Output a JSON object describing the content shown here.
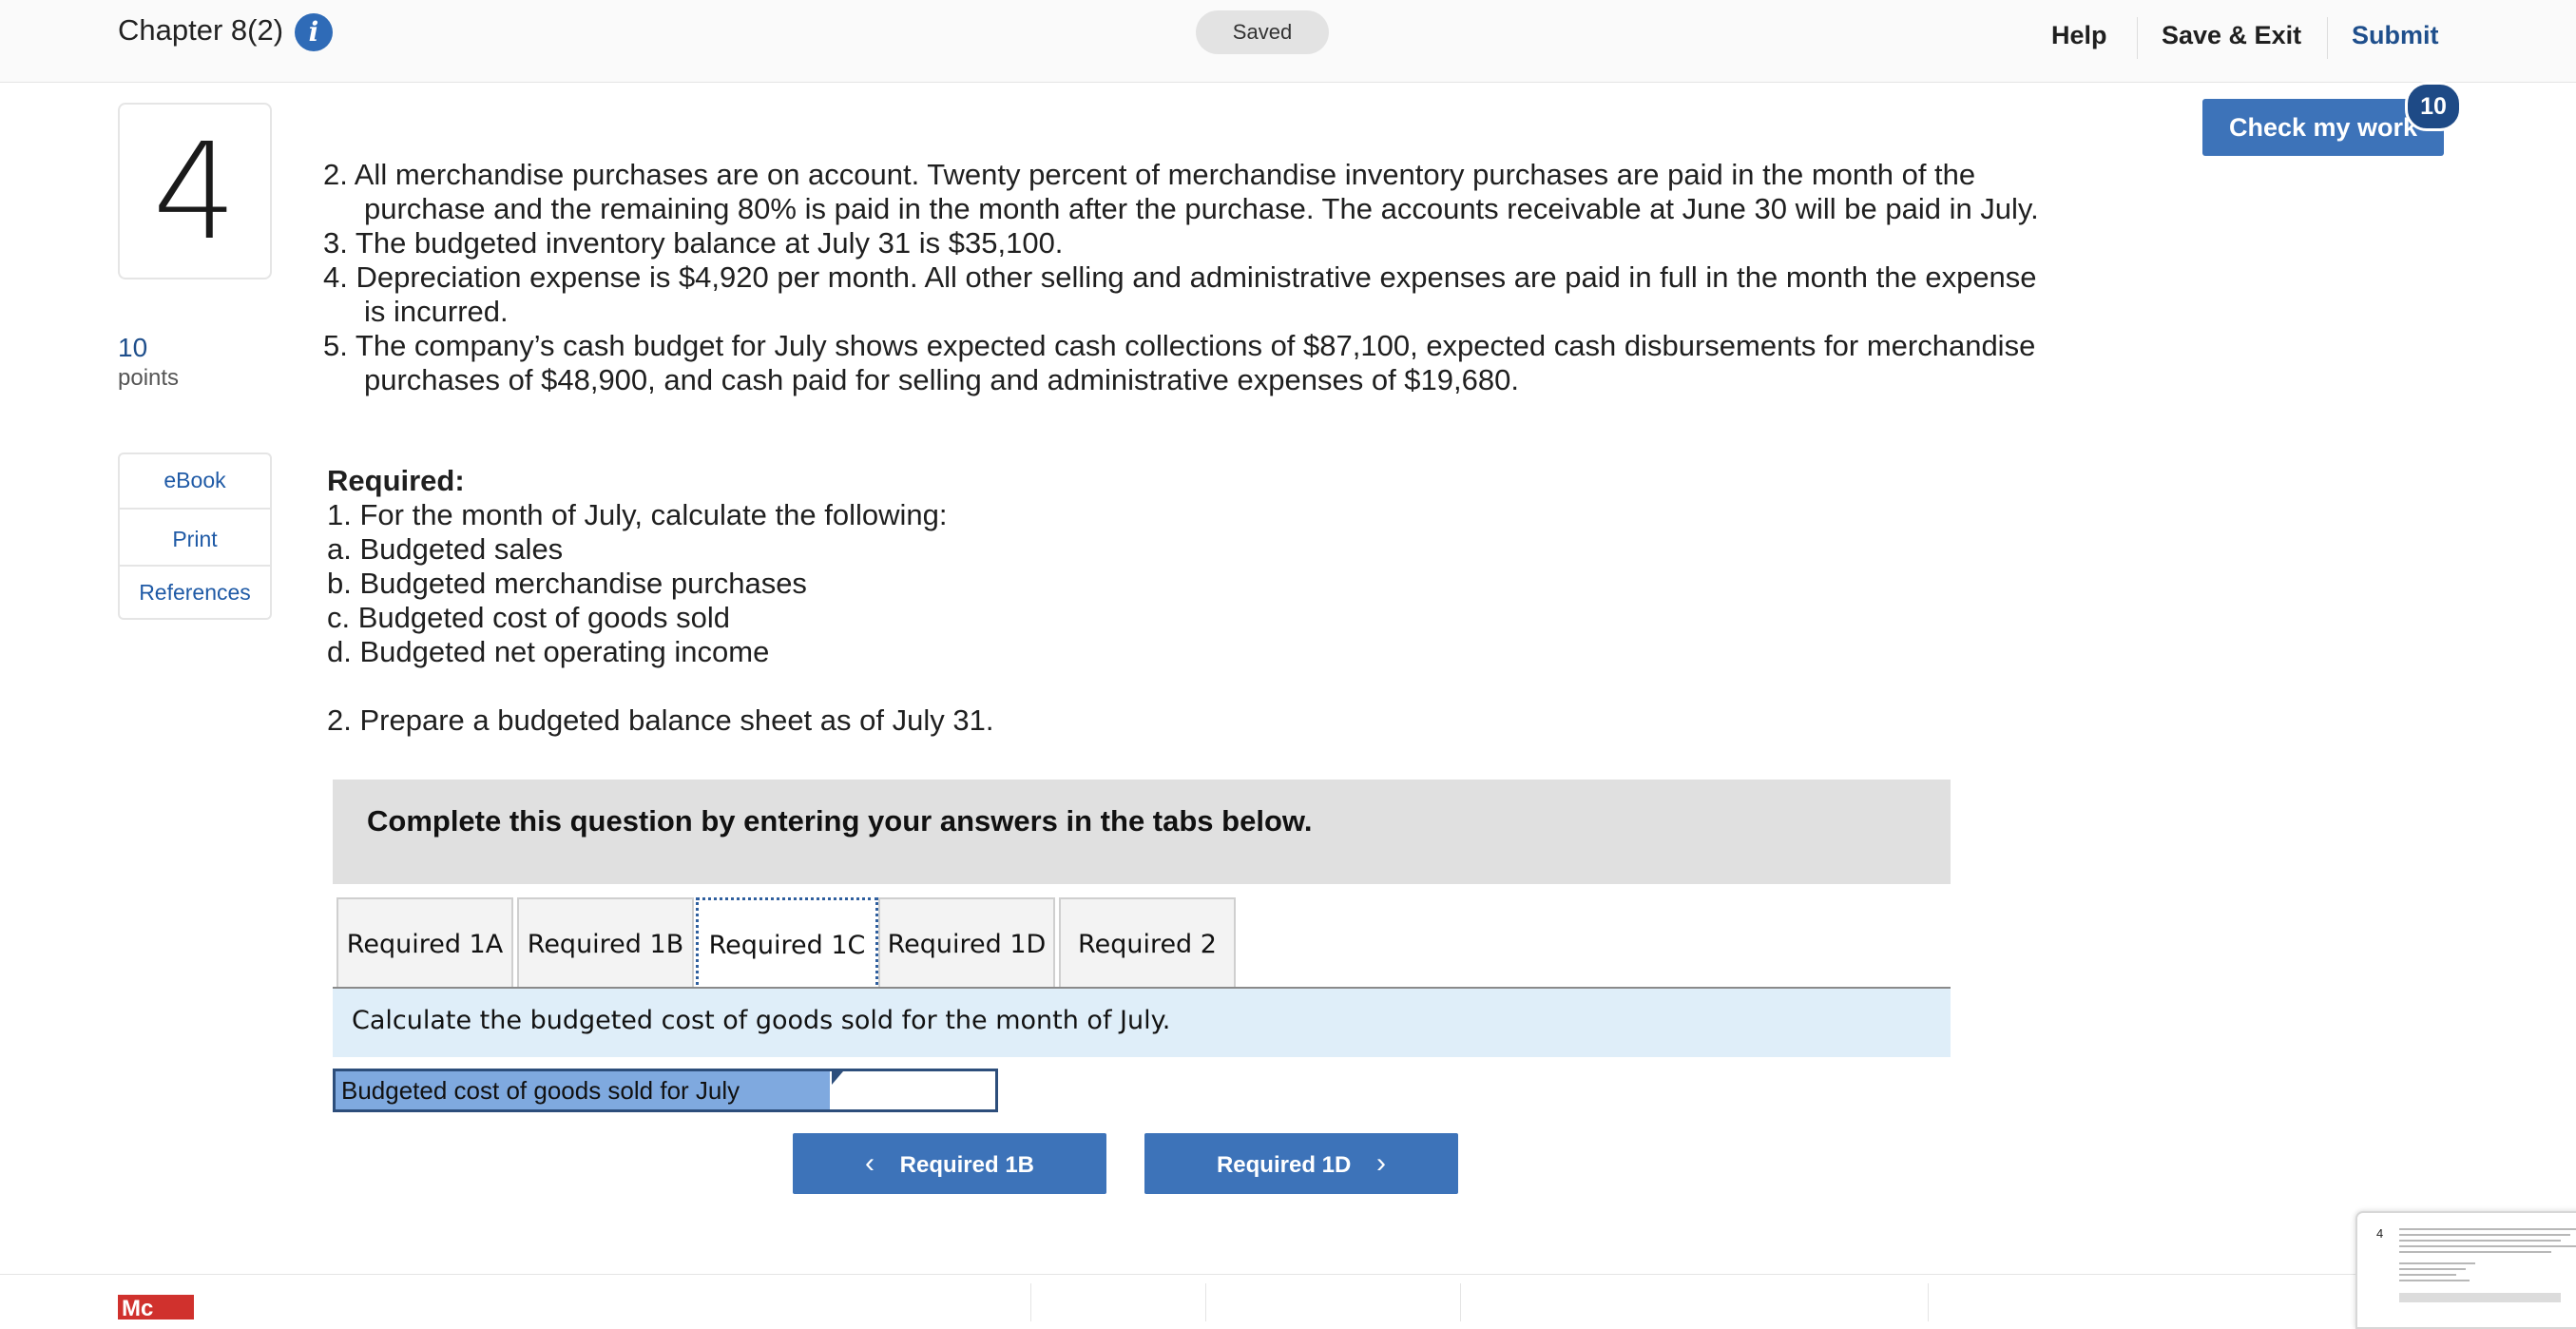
{
  "header": {
    "chapter_title": "Chapter 8(2)",
    "info_icon": "info-icon",
    "status": "Saved",
    "help": "Help",
    "save_exit": "Save & Exit",
    "submit": "Submit"
  },
  "question": {
    "number": "4",
    "points_value": "10",
    "points_label": "points"
  },
  "side_links": [
    "eBook",
    "Print",
    "References"
  ],
  "check_my_work": {
    "label": "Check my work",
    "badge": "10"
  },
  "body_lines": [
    "2.  All merchandise purchases are on account. Twenty percent of merchandise inventory purchases are paid in the month of the",
    "purchase and the remaining 80% is paid in the month after the purchase. The accounts receivable at June 30 will be paid in July.",
    "3.  The budgeted inventory balance at July 31 is $35,100.",
    "4.  Depreciation expense is $4,920 per month. All other selling and administrative expenses are paid in full in the month the expense",
    "is incurred.",
    "5.  The company’s cash budget for July shows expected cash collections of $87,100, expected cash disbursements for merchandise",
    "purchases of $48,900, and cash paid for selling and administrative expenses of $19,680."
  ],
  "required": {
    "title": "Required:",
    "intro": "1. For the month of July, calculate the following:",
    "items": [
      "a. Budgeted sales",
      "b. Budgeted merchandise purchases",
      "c. Budgeted cost of goods sold",
      "d. Budgeted net operating income"
    ],
    "part2": "2. Prepare a budgeted balance sheet as of July 31."
  },
  "instructions": "Complete this question by entering your answers in the tabs below.",
  "tabs": [
    "Required 1A",
    "Required 1B",
    "Required 1C",
    "Required 1D",
    "Required 2"
  ],
  "active_tab": "Required 1C",
  "prompt": "Calculate the budgeted cost of goods sold for the month of July.",
  "answer": {
    "label": "Budgeted cost of goods sold for July",
    "value": ""
  },
  "nav": {
    "prev": "Required 1B",
    "next": "Required 1D"
  },
  "footer": {
    "logo_text": "Mc"
  },
  "thumbnail": {
    "number": "4"
  }
}
